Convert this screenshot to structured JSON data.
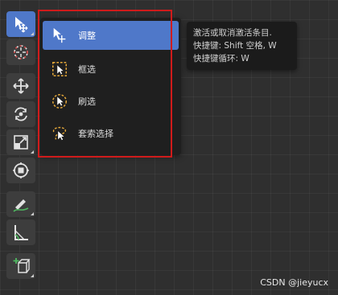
{
  "menu": {
    "items": [
      {
        "label": "调整",
        "icon": "tweak-cursor-icon"
      },
      {
        "label": "框选",
        "icon": "box-select-icon"
      },
      {
        "label": "刷选",
        "icon": "circle-select-icon"
      },
      {
        "label": "套索选择",
        "icon": "lasso-select-icon"
      }
    ]
  },
  "tooltip": {
    "line1": "激活或取消激活条目.",
    "line2": "快捷键: Shift 空格, W",
    "line3": "快捷键循环: W"
  },
  "toolbar": {
    "tools": [
      {
        "name": "select-tool",
        "icon": "select-cursor-icon"
      },
      {
        "name": "cursor-tool",
        "icon": "cursor-target-icon"
      },
      {
        "name": "move-tool",
        "icon": "move-arrows-icon"
      },
      {
        "name": "rotate-tool",
        "icon": "rotate-icon"
      },
      {
        "name": "scale-tool",
        "icon": "scale-icon"
      },
      {
        "name": "transform-tool",
        "icon": "transform-icon"
      },
      {
        "name": "annotate-tool",
        "icon": "annotate-pencil-icon"
      },
      {
        "name": "measure-tool",
        "icon": "measure-icon"
      },
      {
        "name": "add-cube-tool",
        "icon": "add-cube-icon"
      }
    ]
  },
  "watermark": "CSDN @jieyucx"
}
